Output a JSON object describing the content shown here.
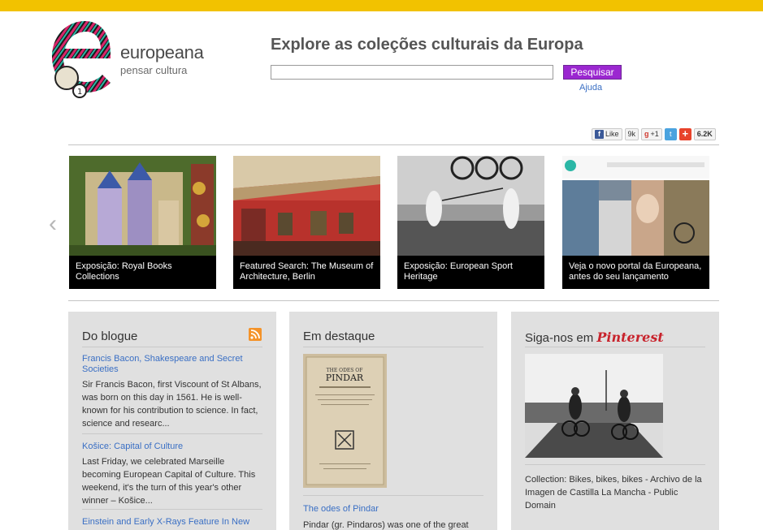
{
  "header": {
    "logo_word": "europeana",
    "logo_tagline": "pensar cultura",
    "search_title": "Explore as coleções culturais da Europa",
    "search_value": "",
    "search_button": "Pesquisar",
    "help_link": "Ajuda"
  },
  "social": {
    "like_label": "Like",
    "like_count": "9k",
    "gplus_label": "+1",
    "share_count": "6.2K"
  },
  "carousel": {
    "prev_icon": "chevron-left-icon",
    "slides": [
      {
        "caption": "Exposição: Royal Books Collections"
      },
      {
        "caption": "Featured Search: The Museum of Architecture, Berlin"
      },
      {
        "caption": "Exposição: European Sport Heritage"
      },
      {
        "caption": "Veja o novo portal da Europeana, antes do seu lançamento"
      }
    ]
  },
  "blog": {
    "title": "Do blogue",
    "posts": [
      {
        "title": "Francis Bacon, Shakespeare and Secret Societies",
        "excerpt": "Sir Francis Bacon, first Viscount of St Albans, was born on this day in 1561. He is well-known for his contribution to science. In fact, science and researc..."
      },
      {
        "title": "Košice: Capital of Culture",
        "excerpt": "Last Friday, we celebrated Marseille becoming European Capital of Culture. This weekend, it's the turn of this year's other winner – Košice..."
      },
      {
        "title": "Einstein and Early X-Rays Feature In New",
        "excerpt": ""
      }
    ]
  },
  "featured": {
    "title": "Em destaque",
    "book_title": "THE ODES OF",
    "book_title2": "PINDAR",
    "link": "The odes of Pindar",
    "text": "Pindar (gr. Pindaros) was one of the great"
  },
  "pinterest": {
    "title": "Siga-nos em",
    "brand": "Pinterest",
    "caption": "Collection: Bikes, bikes, bikes - Archivo de la Imagen de Castilla La Mancha - Public Domain"
  }
}
